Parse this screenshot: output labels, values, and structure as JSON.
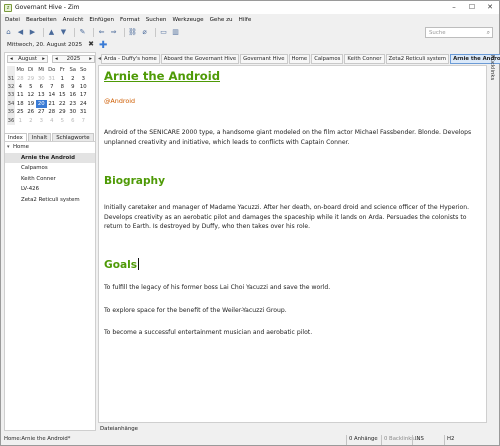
{
  "window": {
    "title": "Governant Hive - Zim"
  },
  "menu": [
    "Datei",
    "Bearbeiten",
    "Ansicht",
    "Einfügen",
    "Format",
    "Suchen",
    "Werkzeuge",
    "Gehe zu",
    "Hilfe"
  ],
  "toolbar": {
    "search_placeholder": "Suche"
  },
  "date_label": "Mittwoch, 20. August 2025",
  "calendar": {
    "month": "August",
    "year": "2025",
    "weekday_headers": [
      "Mo",
      "Di",
      "Mi",
      "Do",
      "Fr",
      "Sa",
      "So"
    ],
    "weeks": [
      {
        "num": "31",
        "days": [
          "28",
          "29",
          "30",
          "31",
          "1",
          "2",
          "3"
        ]
      },
      {
        "num": "32",
        "days": [
          "4",
          "5",
          "6",
          "7",
          "8",
          "9",
          "10"
        ]
      },
      {
        "num": "33",
        "days": [
          "11",
          "12",
          "13",
          "14",
          "15",
          "16",
          "17"
        ]
      },
      {
        "num": "34",
        "days": [
          "18",
          "19",
          "20",
          "21",
          "22",
          "23",
          "24"
        ]
      },
      {
        "num": "35",
        "days": [
          "25",
          "26",
          "27",
          "28",
          "29",
          "30",
          "31"
        ]
      },
      {
        "num": "36",
        "days": [
          "1",
          "2",
          "3",
          "4",
          "5",
          "6",
          "7"
        ]
      }
    ]
  },
  "side_tabs": [
    "Index",
    "Inhalt",
    "Schlagworte"
  ],
  "tree": {
    "root": "Home",
    "children": [
      "Arnie the Android",
      "Calpamos",
      "Keith Conner",
      "LV-426",
      "Zeta2 Reticuli system"
    ]
  },
  "pathbar": [
    "Arda - Duffy's home",
    "Aboard the Governant Hive",
    "Governant Hive",
    "Home",
    "Calpamos",
    "Keith Conner",
    "Zeta2 Reticuli system",
    "Arnie the Android"
  ],
  "page": {
    "title": "Arnie the Android",
    "tag": "@Android",
    "intro": "Android of the SENICARE 2000 type, a handsome giant modeled on the film actor Michael Fassbender. Blonde. Develops unplanned creativity and initiative, which leads to conflicts with Captain Conner.",
    "bio_heading": "Biography",
    "bio": "Initially caretaker and manager of Madame Yacuzzi. After her death, on-board droid and science officer of the Hyperion. Develops creativity as an aerobatic pilot and damages the spaceship while it lands on Arda. Persuades the colonists to return to Earth. Is destroyed by Duffy, who then takes over his role.",
    "goals_heading": "Goals",
    "goals": [
      "To fulfill the legacy of his former boss Lai Choi Yacuzzi and save the world.",
      "To explore space for the benefit of the Weiler-Yacuzzi Group.",
      "To become a successful entertainment musician and aerobatic pilot."
    ]
  },
  "attachments_label": "Dateianhänge",
  "right_pane_label": "Rücklinks",
  "status": {
    "path": "Home:Arnie the Android*",
    "attachments": "0 Anhänge",
    "backlinks": "0 Backlinks...",
    "mode": "INS",
    "style": "H2"
  },
  "colors": {
    "heading": "#4e9a06",
    "tag": "#ce5c00",
    "selection": "#3a7bd5"
  }
}
